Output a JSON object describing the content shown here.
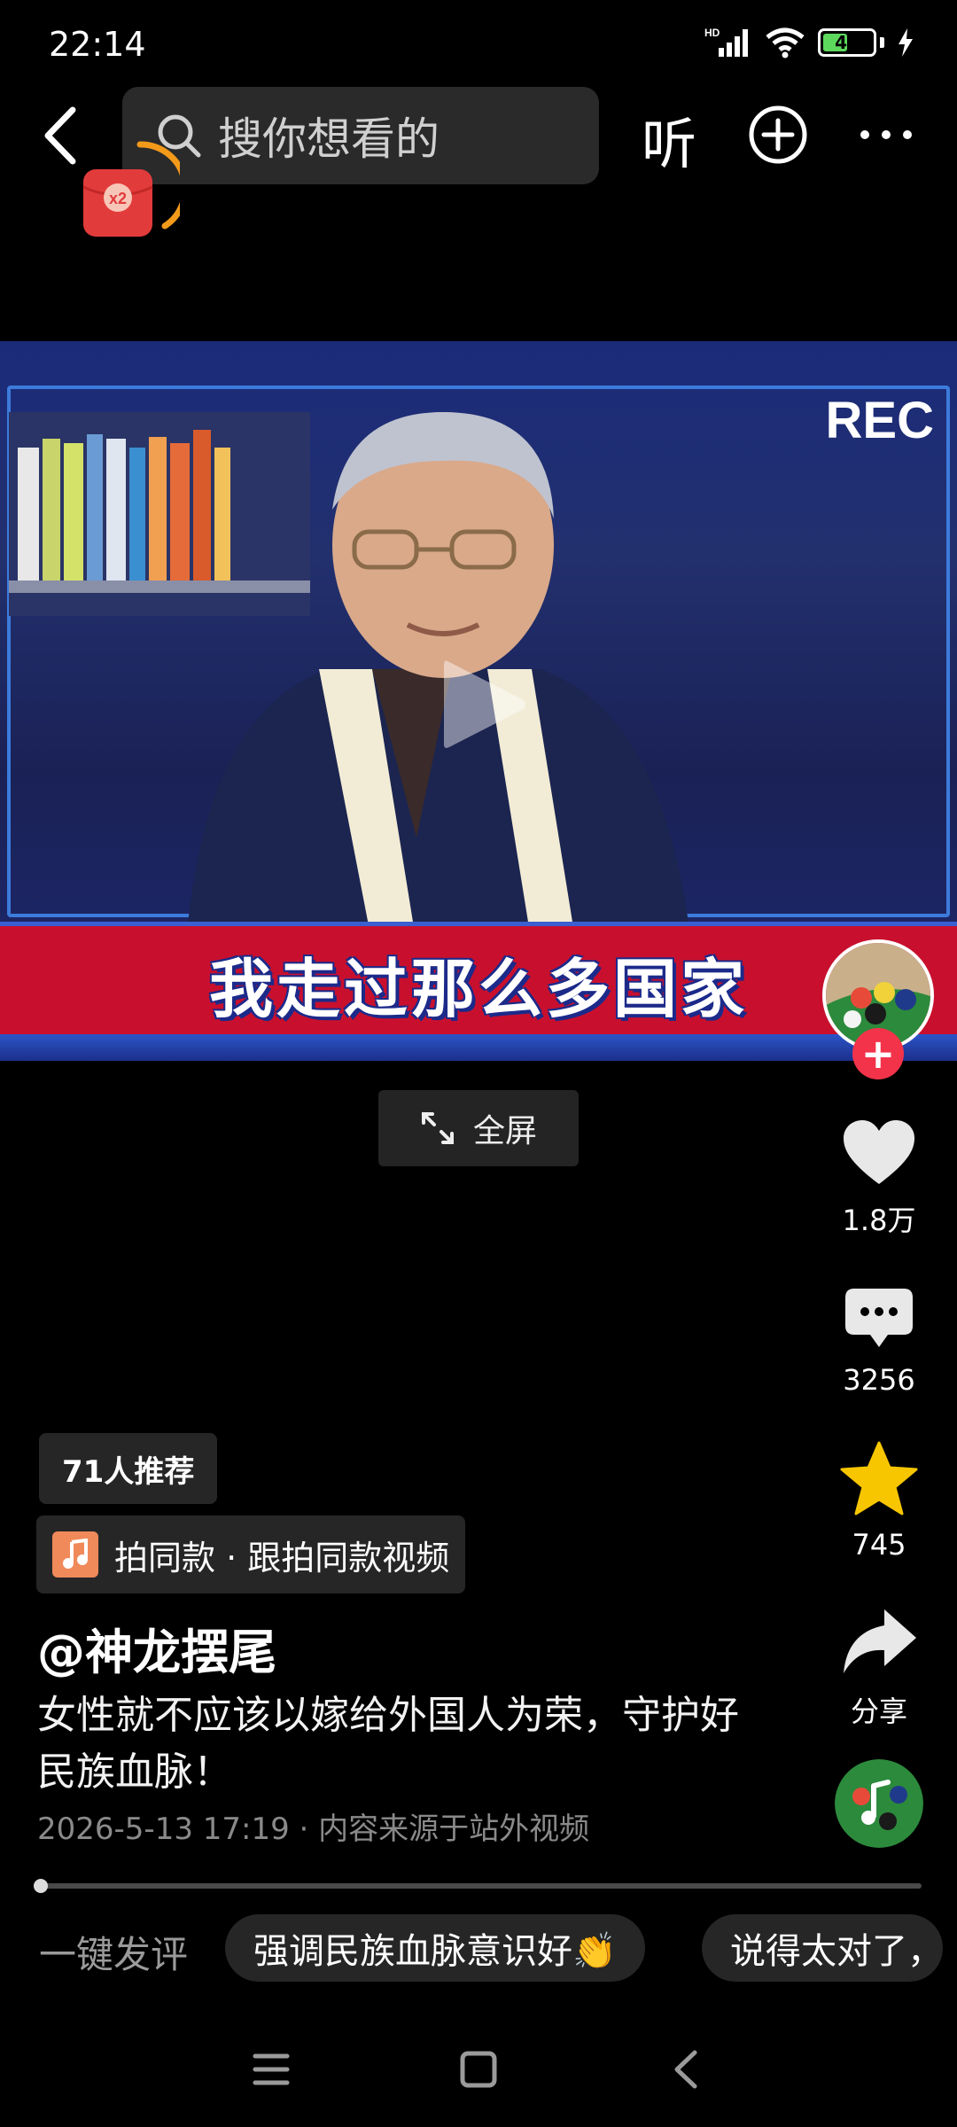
{
  "status_bar": {
    "time": "22:14",
    "network": "HD",
    "battery": "49"
  },
  "top_bar": {
    "search_placeholder": "搜你想看的",
    "listen_label": "听",
    "reward_badge": "x2"
  },
  "video": {
    "rec_label": "REC",
    "caption": "我走过那么多国家",
    "fullscreen_label": "全屏"
  },
  "rail": {
    "likes": "1.8万",
    "comments": "3256",
    "favorites": "745",
    "share_label": "分享"
  },
  "info": {
    "recommend": "71人推荐",
    "same_style": "拍同款 · 跟拍同款视频",
    "author": "@神龙摆尾",
    "description": "女性就不应该以嫁给外国人为荣，守护好民族血脉！",
    "meta": "2026-5-13 17:19 · 内容来源于站外视频"
  },
  "quick_comments": {
    "label": "一键发评",
    "chips": [
      "强调民族血脉意识好👏",
      "说得太对了，"
    ]
  },
  "colors": {
    "accent_red": "#f2334a",
    "favorite_yellow": "#f7c600",
    "caption_red": "#c8102e"
  }
}
